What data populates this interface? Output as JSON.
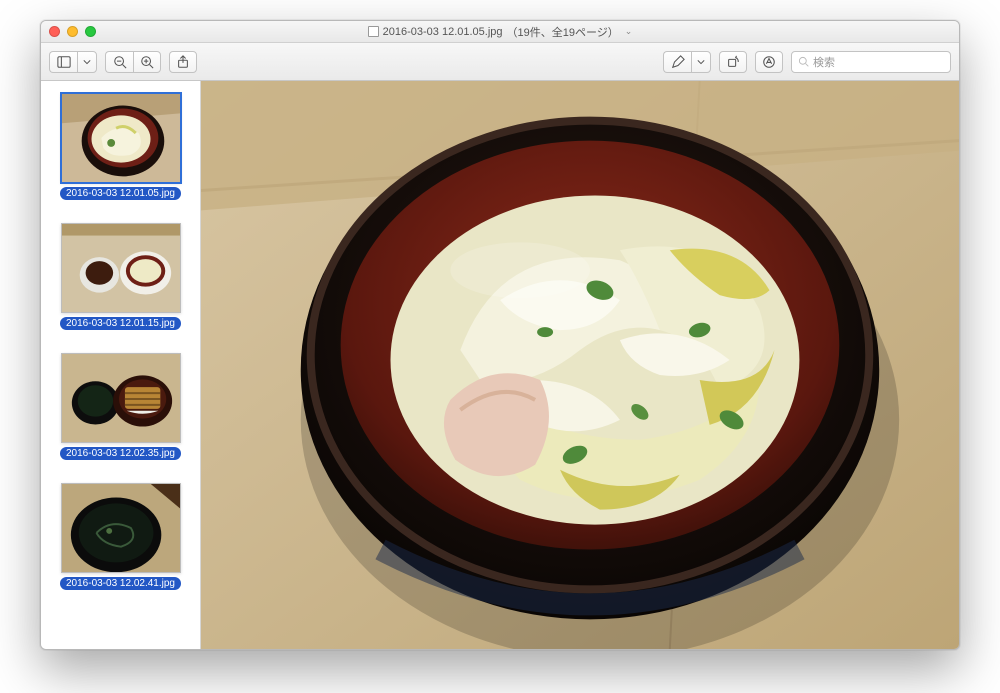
{
  "window": {
    "title_filename": "2016-03-03 12.01.05.jpg",
    "title_meta": "（19件、全19ページ）"
  },
  "toolbar": {
    "view_mode_button": "",
    "zoom_out_button": "",
    "zoom_in_button": "",
    "share_button": "",
    "edit_button": "",
    "rotate_button": "",
    "markup_button": "",
    "annotate_button": ""
  },
  "search": {
    "placeholder": "検索"
  },
  "sidebar": {
    "thumbnails": [
      {
        "label": "2016-03-03 12.01.05.jpg",
        "selected": true
      },
      {
        "label": "2016-03-03 12.01.15.jpg",
        "selected": false
      },
      {
        "label": "2016-03-03 12.02.35.jpg",
        "selected": false
      },
      {
        "label": "2016-03-03 12.02.41.jpg",
        "selected": false
      }
    ]
  }
}
